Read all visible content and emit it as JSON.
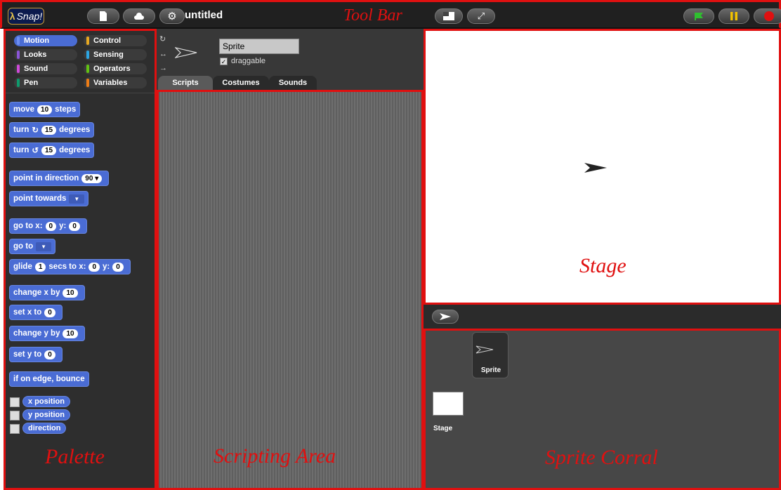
{
  "toolbar": {
    "logo_text": "Snap!",
    "project_title": "untitled",
    "annotation": "Tool Bar",
    "icons": [
      "file-icon",
      "cloud-icon",
      "gear-icon",
      "stage-size-icon",
      "fullscreen-icon",
      "green-flag-icon",
      "pause-icon",
      "stop-icon"
    ],
    "colors": {
      "flag": "#2fbf2f",
      "pause": "#f2c200",
      "stop": "#e01010"
    }
  },
  "palette": {
    "annotation": "Palette",
    "categories": [
      {
        "label": "Motion",
        "color": "#4a6cd4",
        "selected": true
      },
      {
        "label": "Control",
        "color": "#e6a822"
      },
      {
        "label": "Looks",
        "color": "#8a55d7"
      },
      {
        "label": "Sensing",
        "color": "#2ca5e2"
      },
      {
        "label": "Sound",
        "color": "#cf4ad9"
      },
      {
        "label": "Operators",
        "color": "#62c213"
      },
      {
        "label": "Pen",
        "color": "#0e9a6c"
      },
      {
        "label": "Variables",
        "color": "#ee7d16"
      }
    ],
    "blocks": {
      "move": {
        "pre": "move",
        "val": "10",
        "post": "steps"
      },
      "turn_cw": {
        "pre": "turn",
        "val": "15",
        "post": "degrees"
      },
      "turn_ccw": {
        "pre": "turn",
        "val": "15",
        "post": "degrees"
      },
      "point_dir": {
        "pre": "point in direction",
        "val": "90"
      },
      "point_towards": {
        "pre": "point towards"
      },
      "goto_xy": {
        "pre": "go to x:",
        "x": "0",
        "mid": "y:",
        "y": "0"
      },
      "goto": {
        "pre": "go to"
      },
      "glide": {
        "pre": "glide",
        "val": "1",
        "mid": "secs to x:",
        "x": "0",
        "mid2": "y:",
        "y": "0"
      },
      "change_x": {
        "pre": "change x by",
        "val": "10"
      },
      "set_x": {
        "pre": "set x to",
        "val": "0"
      },
      "change_y": {
        "pre": "change y by",
        "val": "10"
      },
      "set_y": {
        "pre": "set y to",
        "val": "0"
      },
      "bounce": {
        "pre": "if on edge, bounce"
      }
    },
    "reporters": [
      "x position",
      "y position",
      "direction"
    ]
  },
  "sprite": {
    "name": "Sprite",
    "draggable_label": "draggable",
    "draggable": true,
    "tabs": [
      "Scripts",
      "Costumes",
      "Sounds"
    ]
  },
  "scripts": {
    "annotation": "Scripting Area"
  },
  "stage": {
    "annotation": "Stage"
  },
  "corral": {
    "annotation": "Sprite Corral",
    "sprite_label": "Sprite",
    "stage_label": "Stage"
  }
}
